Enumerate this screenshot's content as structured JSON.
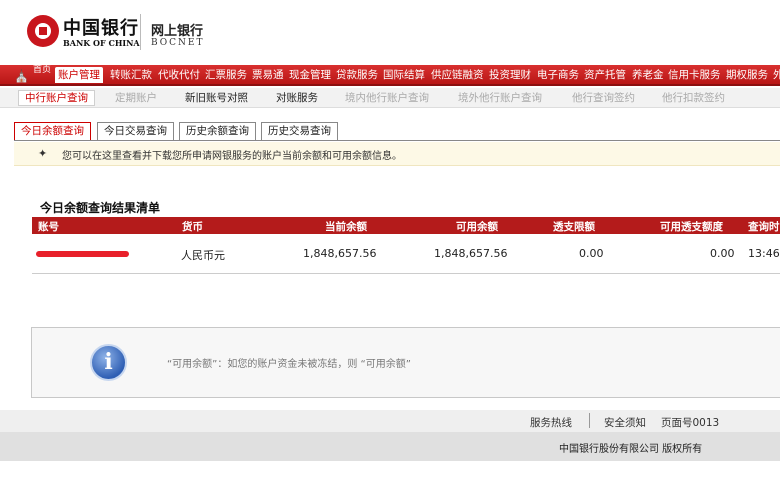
{
  "header": {
    "logo_cn": "中国银行",
    "logo_en": "BANK OF CHINA",
    "product_cn": "网上银行",
    "product_en": "BOCNET"
  },
  "main_nav": {
    "home_label": "首页",
    "items": [
      "账户管理",
      "转账汇款",
      "代收代付",
      "汇票服务",
      "票易通",
      "现金管理",
      "贷款服务",
      "国际结算",
      "供应链融资",
      "投资理财",
      "电子商务",
      "资产托管",
      "养老金",
      "信用卡服务",
      "期权服务",
      "外"
    ],
    "active_index": 0
  },
  "sub_nav": {
    "items": [
      "中行账户查询",
      "定期账户",
      "新旧账号对照",
      "对账服务",
      "境内他行账户查询",
      "境外他行账户查询",
      "他行查询签约",
      "他行扣款签约"
    ]
  },
  "tabs": [
    "今日余额查询",
    "今日交易查询",
    "历史余额查询",
    "历史交易查询"
  ],
  "info": {
    "text": "您可以在这里查看并下载您所申请网银服务的账户当前余额和可用余额信息。"
  },
  "result": {
    "title": "今日余额查询结果清单",
    "columns": [
      "账号",
      "货币",
      "当前余额",
      "可用余额",
      "透支限额",
      "可用透支额度",
      "查询时"
    ],
    "rows": [
      {
        "account": "",
        "currency": "人民币元",
        "current_balance": "1,848,657.56",
        "available_balance": "1,848,657.56",
        "overdraft_limit": "0.00",
        "available_overdraft": "0.00",
        "query_time": "13:46"
      }
    ]
  },
  "tip": {
    "text": "“可用余额”：如您的账户资金未被冻结，则 “可用余额”"
  },
  "footer": {
    "hotline": "服务热线",
    "security": "安全须知",
    "page_no": "页面号0013",
    "copyright": "中国银行股份有限公司 版权所有"
  },
  "colors": {
    "brand_red": "#c8161d",
    "table_header": "#b41b1b",
    "info_bar_bg": "#fdf9e6"
  }
}
